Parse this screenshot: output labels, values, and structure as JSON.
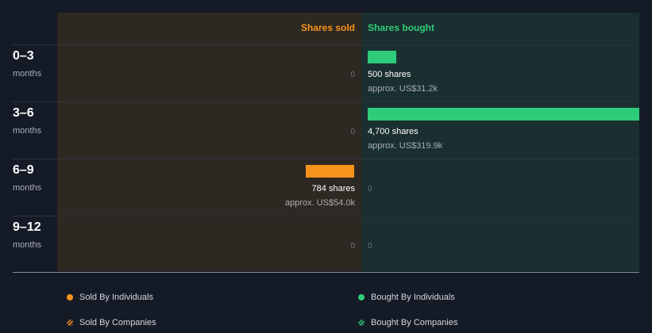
{
  "chart_data": {
    "type": "bar",
    "orientation": "horizontal",
    "categories": [
      {
        "period": "0–3",
        "unit": "months"
      },
      {
        "period": "3–6",
        "unit": "months"
      },
      {
        "period": "6–9",
        "unit": "months"
      },
      {
        "period": "9–12",
        "unit": "months"
      }
    ],
    "headers": {
      "sold": "Shares sold",
      "bought": "Shares bought"
    },
    "series": [
      {
        "name": "Shares sold",
        "values": [
          0,
          0,
          784,
          0
        ],
        "labels": [
          "0",
          "0",
          "784 shares",
          "0"
        ],
        "approx": [
          "",
          "",
          "approx. US$54.0k",
          ""
        ],
        "color": "#f7931a"
      },
      {
        "name": "Shares bought",
        "values": [
          500,
          4700,
          0,
          0
        ],
        "labels": [
          "500 shares",
          "4,700 shares",
          "0",
          "0"
        ],
        "approx": [
          "approx. US$31.2k",
          "approx. US$319.9k",
          "",
          ""
        ],
        "color": "#2ecc7a"
      }
    ],
    "legend": [
      {
        "label": "Sold By Individuals",
        "color": "#f7931a",
        "style": "solid"
      },
      {
        "label": "Bought By Individuals",
        "color": "#2ecc7a",
        "style": "solid"
      },
      {
        "label": "Sold By Companies",
        "color": "#f7931a",
        "style": "hatched"
      },
      {
        "label": "Bought By Companies",
        "color": "#2ecc7a",
        "style": "hatched"
      }
    ],
    "background": {
      "sold": "#2e2822",
      "bought": "#1a2f30",
      "page": "#151b26"
    }
  }
}
